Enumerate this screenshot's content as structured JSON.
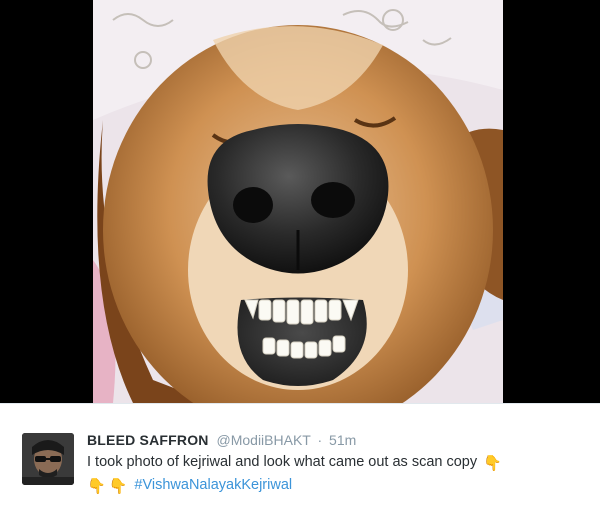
{
  "photo": {
    "watermark": "",
    "subject": "dog-photo"
  },
  "tweet": {
    "display_name": "BLEED SAFFRON",
    "handle": "@ModiiBHAKT",
    "separator": "·",
    "timestamp": "51m",
    "text": "I took photo of kejriwal and look what came out as scan copy",
    "emoji": "👇",
    "hashtag": "#VishwaNalayakKejriwal"
  },
  "colors": {
    "link": "#3b94d9",
    "secondary_text": "#8899a6",
    "primary_text": "#292f33",
    "emoji": "#f5b800"
  },
  "icons": {
    "pointing_down": "backhand-index-pointing-down-icon"
  }
}
